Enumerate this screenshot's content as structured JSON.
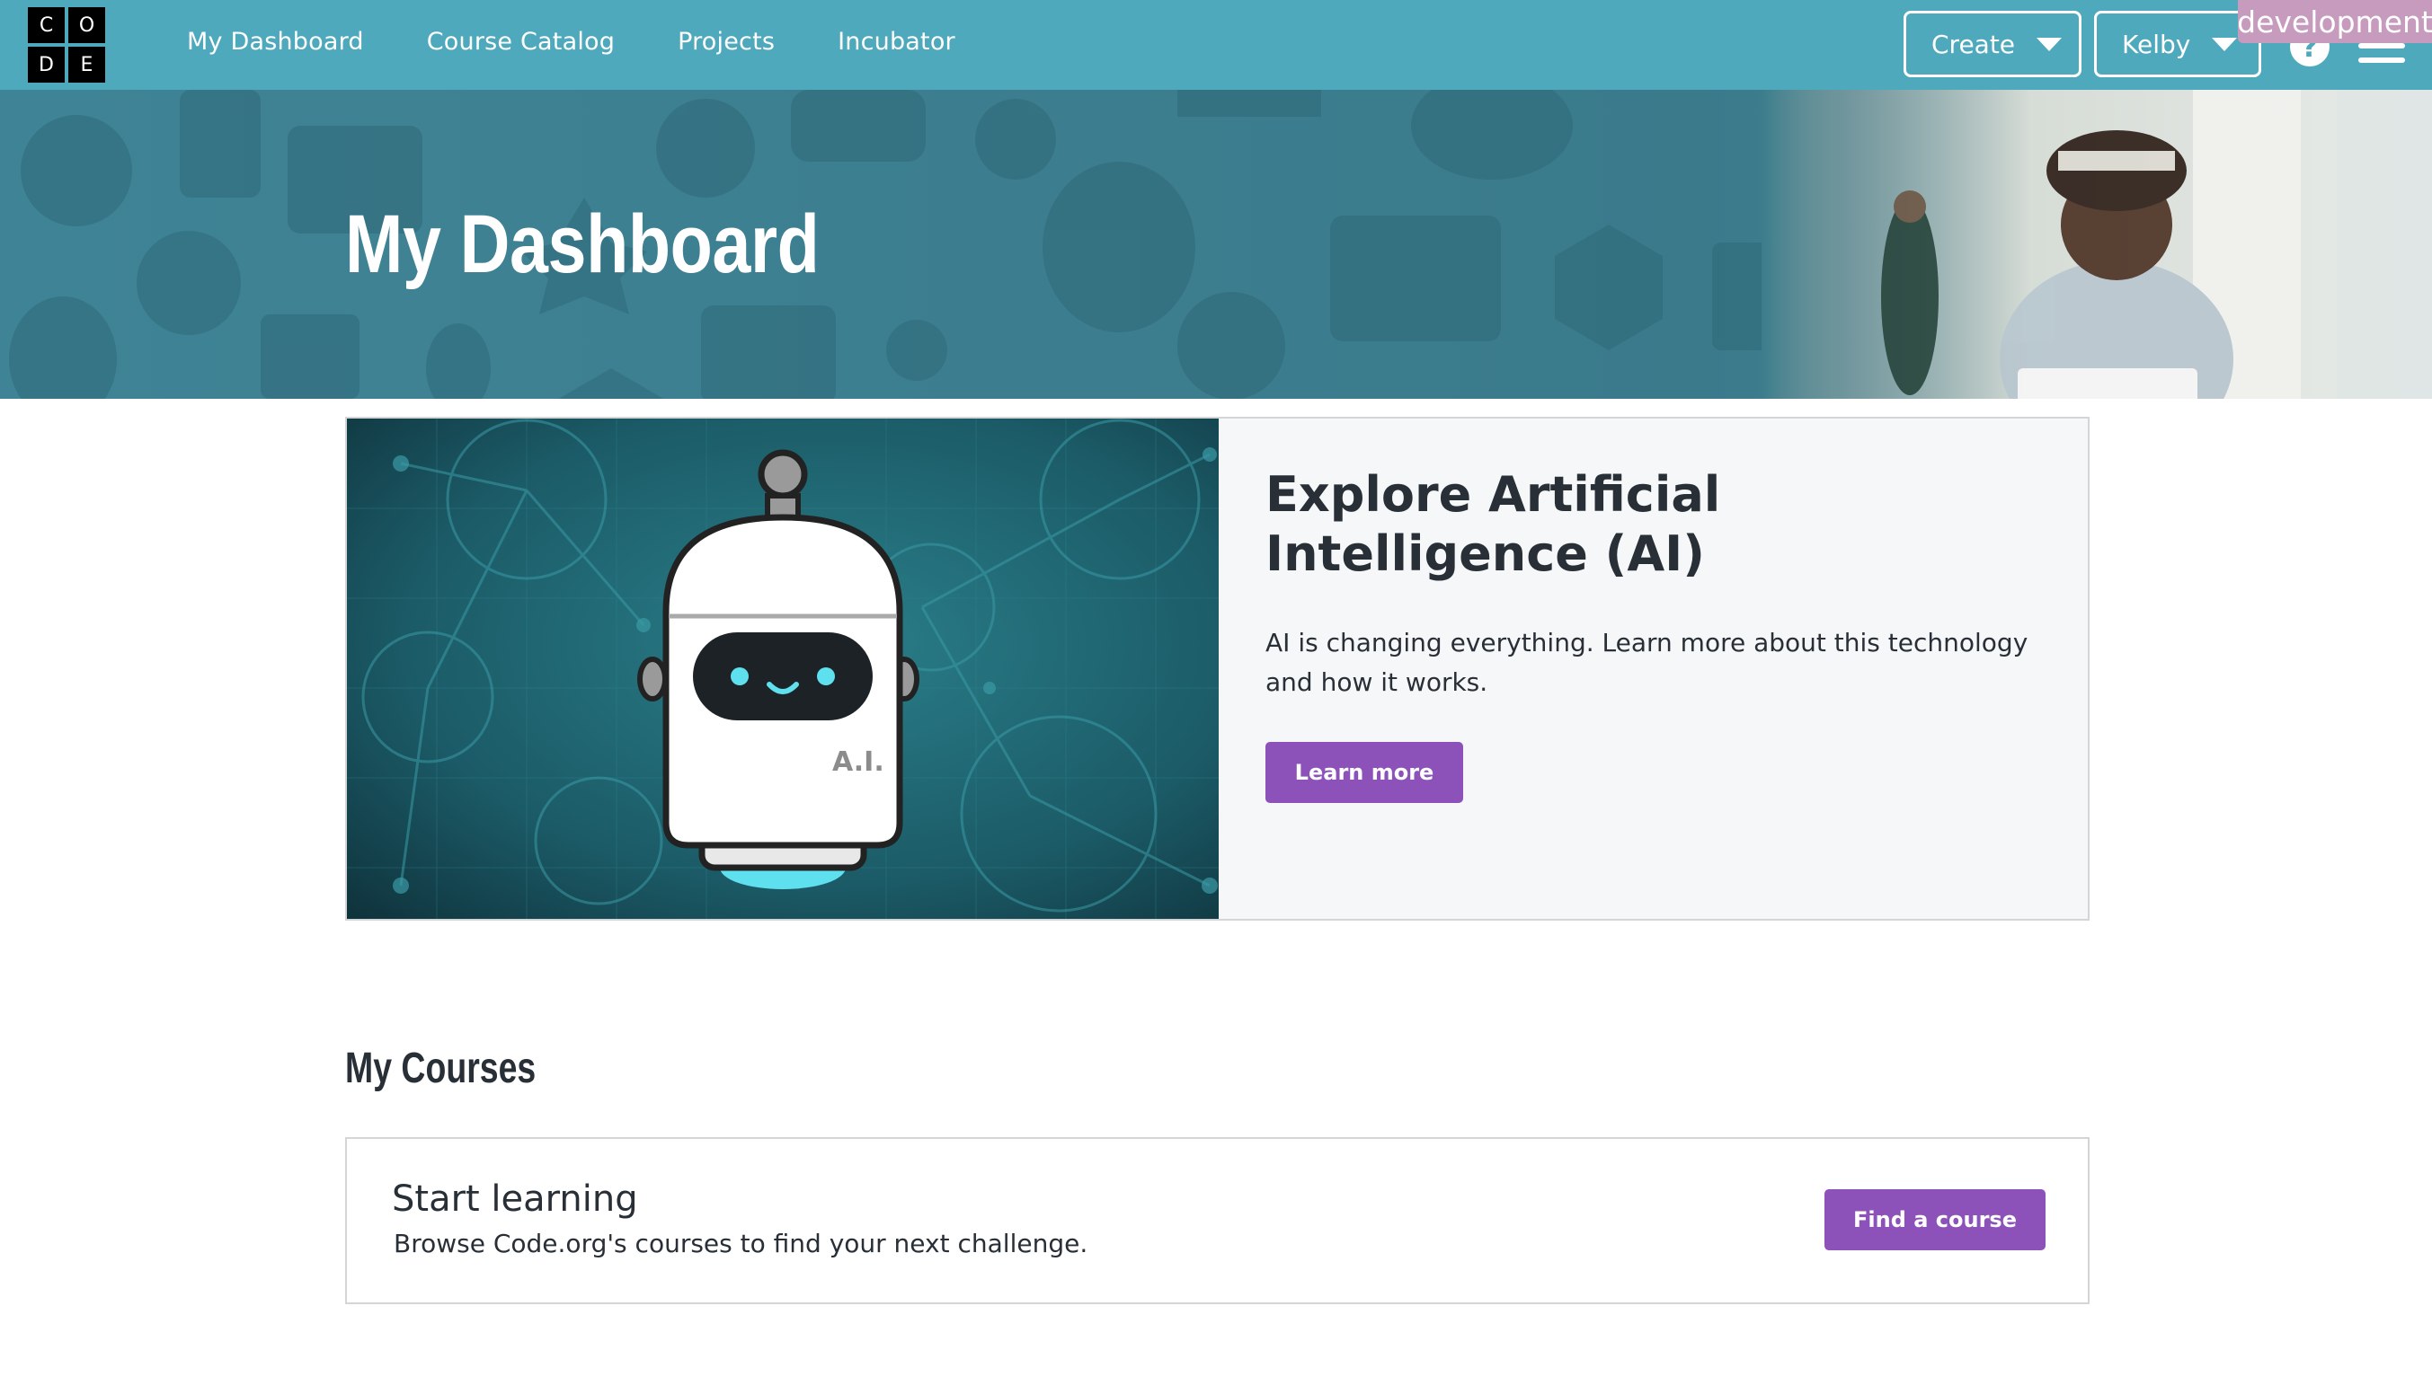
{
  "header": {
    "logo_letters": [
      "C",
      "O",
      "D",
      "E"
    ],
    "nav": [
      {
        "label": "My Dashboard"
      },
      {
        "label": "Course Catalog"
      },
      {
        "label": "Projects"
      },
      {
        "label": "Incubator"
      }
    ],
    "create_label": "Create",
    "user_label": "Kelby",
    "help_icon": "question-circle-icon",
    "menu_icon": "hamburger-icon",
    "environment_badge": "development"
  },
  "hero": {
    "title": "My Dashboard"
  },
  "promo": {
    "title": "Explore Artificial Intelligence (AI)",
    "description": "AI is changing everything. Learn more about this technology and how it works.",
    "button_label": "Learn more",
    "robot_label": "A.I."
  },
  "courses": {
    "heading": "My Courses",
    "card_title": "Start learning",
    "card_description": "Browse Code.org's courses to find your next challenge.",
    "button_label": "Find a course"
  },
  "colors": {
    "header_bg": "#4fa9bd",
    "accent_purple": "#8c52ba",
    "env_badge": "#c79bbd",
    "text_dark": "#292f36"
  }
}
